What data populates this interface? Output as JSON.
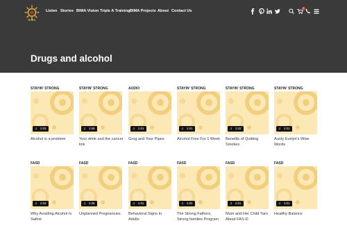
{
  "header": {
    "logo_text": "BIMA",
    "nav": [
      "Listen",
      "Stories",
      "BIMA Vision",
      "Triple A Training",
      "BIMA Projects",
      "About",
      "Contact Us"
    ],
    "social_icons": [
      "facebook-icon",
      "pinterest-icon",
      "linkedin-icon",
      "twitter-icon"
    ],
    "utility_icons": [
      "search-icon",
      "cart-icon",
      "phone-icon",
      "menu-icon"
    ],
    "cart_count": "0",
    "page_title": "Drugs and alcohol"
  },
  "colors": {
    "header_bg": "#3a3a3a",
    "thumb_bg": "#fbe8b4",
    "thumb_circle": "#f2cf7e",
    "accent": "#e8b545"
  },
  "rows": [
    {
      "cards": [
        {
          "category": "STAYIN' STRONG",
          "duration": "1:03",
          "title": "Alcohol is a problem"
        },
        {
          "category": "STAYIN' STRONG",
          "duration": "1:06",
          "title": "Your drink and the cancer link"
        },
        {
          "category": "AUDIO",
          "duration": "1:01",
          "title": "Grog and Your Pipes"
        },
        {
          "category": "STAYIN' STRONG",
          "duration": "1:01",
          "title": "Alcohol-Free For 1 Week"
        },
        {
          "category": "STAYIN' STRONG",
          "duration": "1:02",
          "title": "Benefits of Quitting Smokes"
        },
        {
          "category": "STAYIN' STRONG",
          "duration": "1:01",
          "title": "Aunty Evelyn's Wise Words"
        }
      ]
    },
    {
      "cards": [
        {
          "category": "FASD",
          "duration": "1:03",
          "title": "Why Avoiding Alcohol Is Safest"
        },
        {
          "category": "FASD",
          "duration": "1:06",
          "title": "Unplanned Pregnancies"
        },
        {
          "category": "FASD",
          "duration": "1:01",
          "title": "Behavioral Signs In Adults"
        },
        {
          "category": "FASD",
          "duration": "1:02",
          "title": "The Strong Fathers, Strong families Program"
        },
        {
          "category": "FASD",
          "duration": "1:01",
          "title": "Mum and Her Child Yarn About FAS-D"
        },
        {
          "category": "FASD",
          "duration": "1:01",
          "title": "Healthy Balance"
        }
      ]
    }
  ]
}
